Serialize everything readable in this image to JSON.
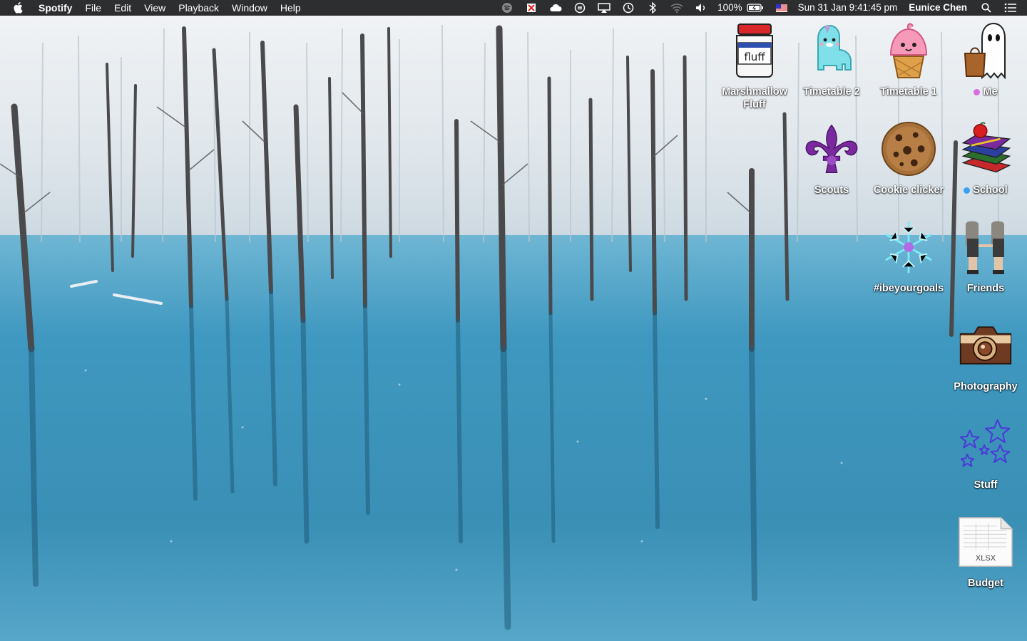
{
  "menubar": {
    "app_name": "Spotify",
    "menus": [
      "File",
      "Edit",
      "View",
      "Playback",
      "Window",
      "Help"
    ],
    "battery_percent": "100%",
    "datetime": "Sun 31 Jan  9:41:45 pm",
    "user": "Eunice Chen"
  },
  "desktop": {
    "icons": [
      {
        "label": "Marshmallow Fluff",
        "icon": "marshmallow-jar-icon"
      },
      {
        "label": "Timetable 2",
        "icon": "alpaca-icon"
      },
      {
        "label": "Timetable 1",
        "icon": "cupcake-icon"
      },
      {
        "label": "Me",
        "icon": "ghost-icon",
        "tag_color": "#d86be0"
      },
      {
        "label": "Scouts",
        "icon": "fleur-de-lis-icon"
      },
      {
        "label": "Cookie clicker",
        "icon": "cookie-icon"
      },
      {
        "label": "School",
        "icon": "books-icon",
        "tag_color": "#3aa0f0"
      },
      {
        "label": "#ibeyourgoals",
        "icon": "snowflake-icon"
      },
      {
        "label": "Friends",
        "icon": "friends-icon"
      },
      {
        "label": "Photography",
        "icon": "camera-icon"
      },
      {
        "label": "Stuff",
        "icon": "stars-icon"
      },
      {
        "label": "Budget",
        "icon": "xlsx-file-icon",
        "file_badge": "XLSX"
      }
    ]
  },
  "colors": {
    "water": "#3f93b8",
    "snow": "#e6edf2",
    "menubar": "#1c1c1e"
  }
}
